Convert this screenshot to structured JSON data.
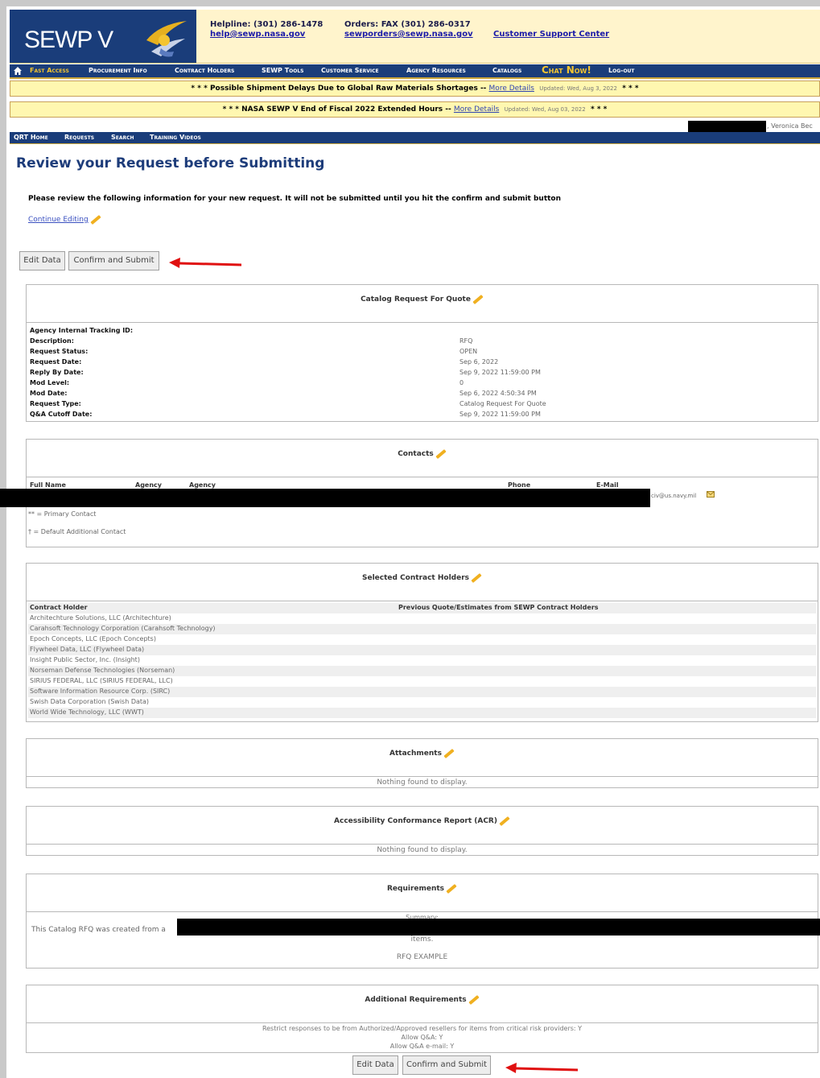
{
  "header": {
    "logo": "SEWP V",
    "helpline": "Helpline: (301) 286-1478",
    "help_email": "help@sewp.nasa.gov",
    "orders": "Orders: FAX (301) 286-0317",
    "orders_email": "sewporders@sewp.nasa.gov",
    "support_center": "Customer Support Center"
  },
  "nav": {
    "items": [
      "Fast Access",
      "Procurement Info",
      "Contract Holders",
      "SEWP Tools",
      "Customer Service",
      "Agency Resources",
      "Catalogs"
    ],
    "chat_now": "Chat Now!",
    "logout": "Log-out"
  },
  "alerts": [
    {
      "prefix": "* * * Possible Shipment Delays Due to Global Raw Materials Shortages -- ",
      "link": "More Details",
      "updated": "Updated: Wed, Aug 3, 2022",
      "suffix": "* * *"
    },
    {
      "prefix": "* * * NASA SEWP V End of Fiscal 2022 Extended Hours -- ",
      "link": "More Details",
      "updated": "Updated: Wed, Aug 03, 2022",
      "suffix": "* * *"
    }
  ],
  "user_suffix": ", Veronica Bec",
  "subnav": [
    "QRT Home",
    "Requests",
    "Search",
    "Training Videos"
  ],
  "page": {
    "title": "Review your Request before Submitting",
    "instructions": "Please review the following information for your new request. It will not be submitted until you hit the confirm and submit button",
    "continue_editing": "Continue Editing",
    "edit_data": "Edit Data",
    "confirm_submit": "Confirm and Submit"
  },
  "catalog": {
    "title": "Catalog Request For Quote",
    "fields": [
      {
        "k": "Agency Internal Tracking ID:",
        "v": ""
      },
      {
        "k": "Description:",
        "v": "RFQ"
      },
      {
        "k": "Request Status:",
        "v": "OPEN"
      },
      {
        "k": "Request Date:",
        "v": "Sep 6, 2022"
      },
      {
        "k": "Reply By Date:",
        "v": "Sep 9, 2022 11:59:00 PM"
      },
      {
        "k": "Mod Level:",
        "v": "0"
      },
      {
        "k": "Mod Date:",
        "v": "Sep 6, 2022 4:50:34 PM"
      },
      {
        "k": "Request Type:",
        "v": "Catalog Request For Quote"
      },
      {
        "k": "Q&A Cutoff Date:",
        "v": "Sep 9, 2022 11:59:00 PM"
      }
    ]
  },
  "contacts": {
    "title": "Contacts",
    "headers": [
      "Full Name",
      "Agency",
      "Agency",
      "Phone",
      "E-Mail"
    ],
    "email_tail": "civ@us.navy.mil",
    "primary_note": "** = Primary Contact",
    "default_note": "† = Default Additional Contact"
  },
  "holders": {
    "title": "Selected Contract Holders",
    "col1": "Contract Holder",
    "col2": "Previous Quote/Estimates from SEWP Contract Holders",
    "rows": [
      "Architechture Solutions, LLC (Architechture)",
      "Carahsoft Technology Corporation (Carahsoft Technology)",
      "Epoch Concepts, LLC (Epoch Concepts)",
      "Flywheel Data, LLC (Flywheel Data)",
      "Insight Public Sector, Inc. (Insight)",
      "Norseman Defense Technologies (Norseman)",
      "SIRIUS FEDERAL, LLC (SIRIUS FEDERAL, LLC)",
      "Software Information Resource Corp. (SIRC)",
      "Swish Data Corporation (Swish Data)",
      "World Wide Technology, LLC (WWT)"
    ]
  },
  "attachments": {
    "title": "Attachments",
    "empty": "Nothing found to display."
  },
  "acr": {
    "title": "Accessibility Conformance Report (ACR)",
    "empty": "Nothing found to display."
  },
  "requirements": {
    "title": "Requirements",
    "summary_label": "Summary:",
    "text_start": "This Catalog RFQ was created from a",
    "items": "items.",
    "example": "RFQ EXAMPLE"
  },
  "additional": {
    "title": "Additional Requirements",
    "line1": "Restrict responses to be from Authorized/Approved resellers for items from critical risk providers: Y",
    "line2": "Allow Q&A: Y",
    "line3": "Allow Q&A e-mail: Y"
  }
}
